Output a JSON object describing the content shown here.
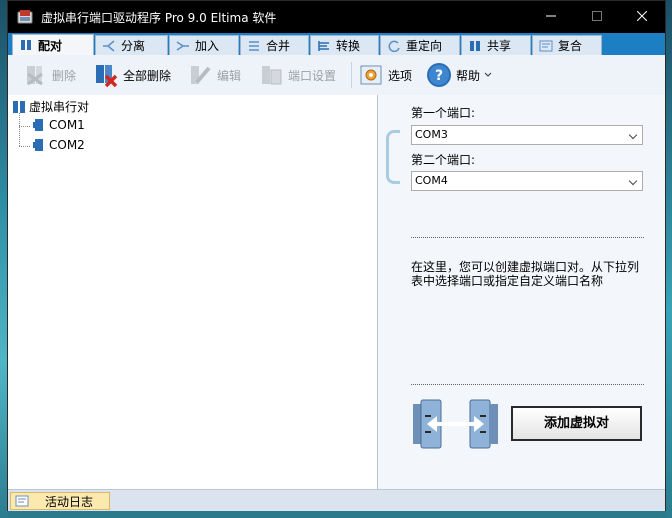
{
  "window": {
    "title": "虚拟串行端口驱动程序 Pro 9.0 Eltima 软件"
  },
  "tabs": [
    {
      "label": "配对",
      "icon": "pair-icon",
      "active": true
    },
    {
      "label": "分离",
      "icon": "split-icon"
    },
    {
      "label": "加入",
      "icon": "join-icon"
    },
    {
      "label": "合并",
      "icon": "merge-icon"
    },
    {
      "label": "转换",
      "icon": "convert-icon"
    },
    {
      "label": "重定向",
      "icon": "redirect-icon"
    },
    {
      "label": "共享",
      "icon": "share-icon"
    },
    {
      "label": "复合",
      "icon": "composite-icon"
    }
  ],
  "toolbar": {
    "delete_label": "删除",
    "delete_all_label": "全部删除",
    "edit_label": "编辑",
    "port_settings_label": "端口设置",
    "options_label": "选项",
    "help_label": "帮助"
  },
  "tree": {
    "root_label": "虚拟串行对",
    "ports": [
      "COM1",
      "COM2"
    ]
  },
  "panel": {
    "first_port_label": "第一个端口:",
    "first_port_value": "COM3",
    "second_port_label": "第二个端口:",
    "second_port_value": "COM4",
    "description": "在这里，您可以创建虚拟端口对。从下拉列表中选择端口或指定自定义端口名称",
    "add_button_label": "添加虚拟对"
  },
  "status": {
    "log_tab_label": "活动日志"
  },
  "colors": {
    "tab_strip": "#1c7fc4",
    "accent": "#2a6db5",
    "delete_all_red": "#d4261f"
  }
}
